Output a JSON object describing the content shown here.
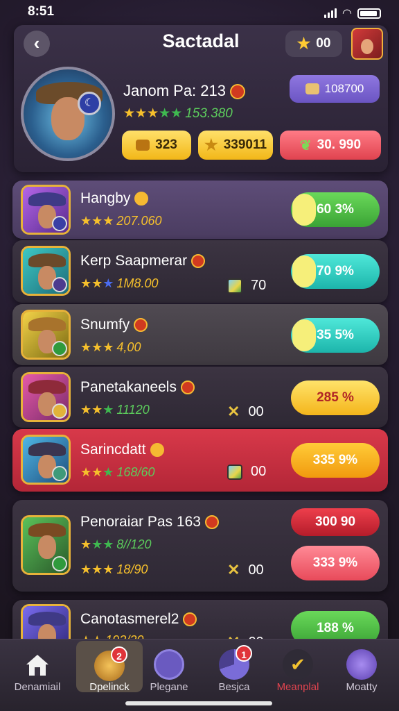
{
  "status_bar": {
    "time": "8:51"
  },
  "header": {
    "title": "Sactadal",
    "star_count": "00",
    "player_name": "Janom Pa: 213",
    "player_score": "153.380",
    "shop_value": "108700",
    "resources": [
      {
        "value": "323",
        "icon": "chest-icon"
      },
      {
        "value": "339011",
        "icon": "star-icon"
      },
      {
        "value": "30. 990",
        "icon": "leaf-icon"
      }
    ]
  },
  "leaderboard": [
    {
      "name": "Hangby",
      "score": "207.060",
      "percent": "60 3%",
      "percent_value": 60.3
    },
    {
      "name": "Kerp Saapmerar",
      "score": "1M8.00",
      "item_value": "70",
      "percent": "70 9%",
      "percent_value": 70.9
    },
    {
      "name": "Snumfy",
      "score": "4,00",
      "percent": "35 5%",
      "percent_value": 35.5
    },
    {
      "name": "Panetakaneels",
      "score": "11120",
      "item_value": "00",
      "percent": "285 %"
    },
    {
      "name": "Sarincdatt",
      "score": "168/60",
      "item_value": "00",
      "percent": "335 9%"
    },
    {
      "name": "Penoraiar Pas 163",
      "score_a": "8//120",
      "score_b": "18/90",
      "item_value": "00",
      "percent_a": "300 90",
      "percent_b": "333 9%"
    },
    {
      "name": "Canotasmerel2",
      "score": "193/30",
      "item_value": "00",
      "percent": "188 %"
    }
  ],
  "tabs": [
    {
      "label": "Denamiail",
      "badge": ""
    },
    {
      "label": "Dpelinck",
      "badge": "2"
    },
    {
      "label": "Plegane",
      "badge": ""
    },
    {
      "label": "Besjca",
      "badge": "1"
    },
    {
      "label": "Meanplal",
      "badge": ""
    },
    {
      "label": "Moatty",
      "badge": ""
    }
  ],
  "colors": {
    "accent_red": "#d8394a",
    "gold": "#f6c02c",
    "green": "#3aa335",
    "teal": "#1db5ab"
  }
}
